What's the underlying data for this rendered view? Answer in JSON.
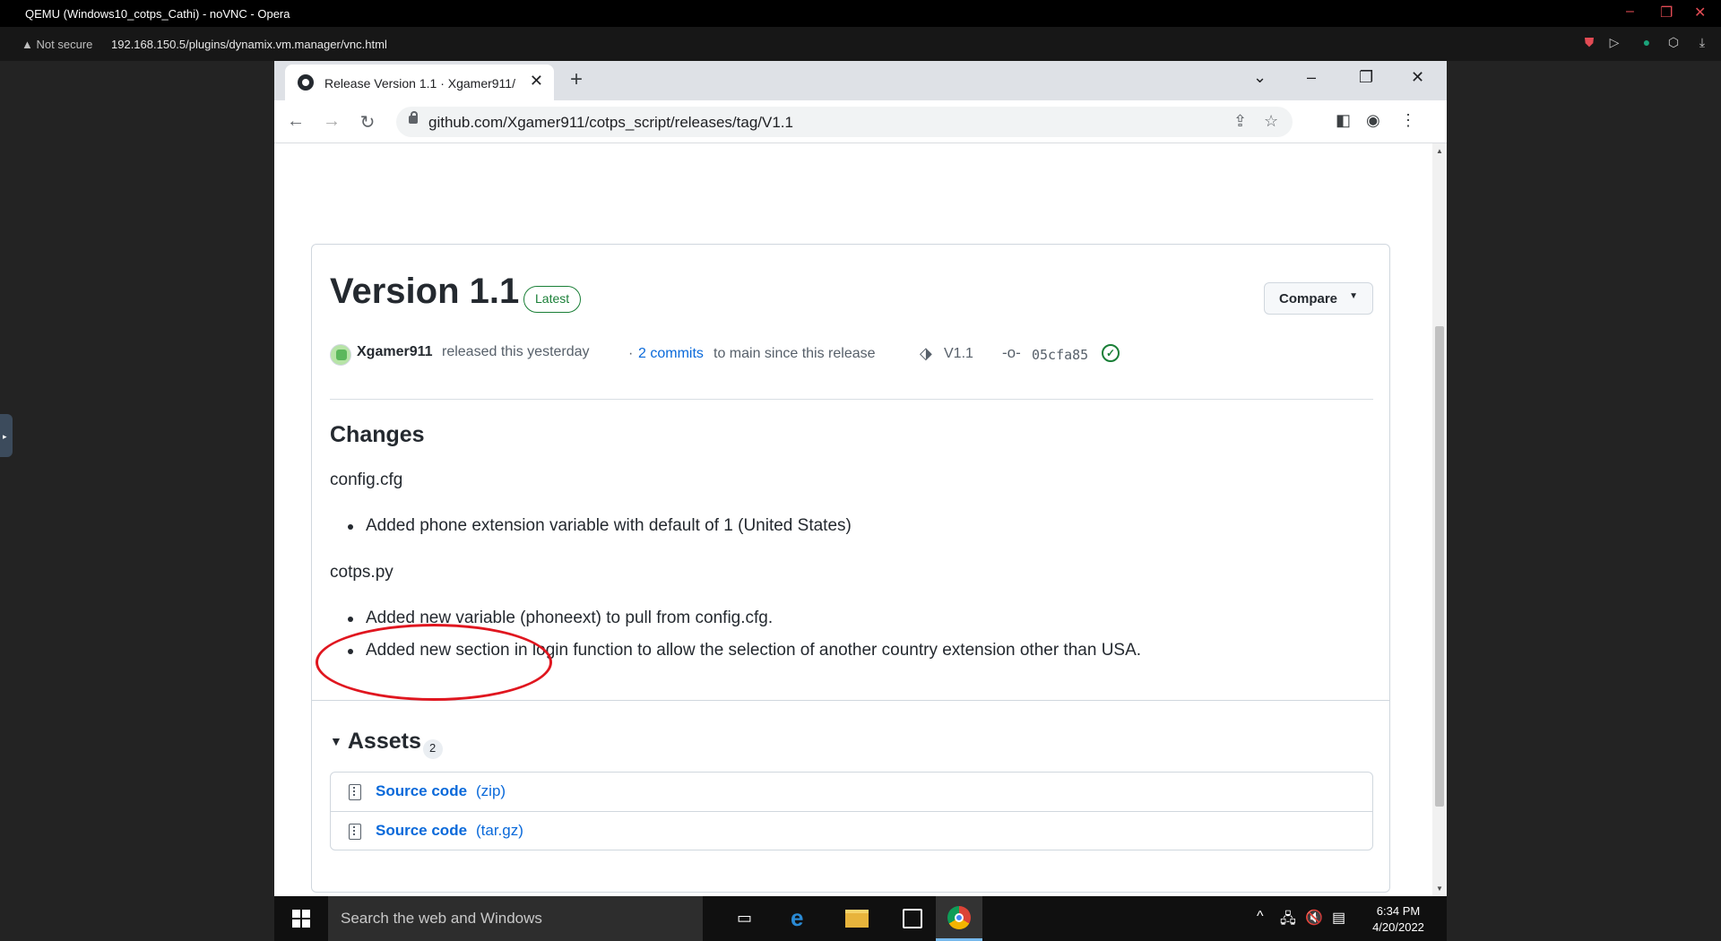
{
  "opera": {
    "title": "QEMU (Windows10_cotps_Cathi) - noVNC - Opera",
    "not_secure": "Not secure",
    "url": "192.168.150.5/plugins/dynamix.vm.manager/vnc.html"
  },
  "chrome": {
    "tab_title": "Release Version 1.1 · Xgamer911/",
    "url": "github.com/Xgamer911/cotps_script/releases/tag/V1.1"
  },
  "release": {
    "title": "Version 1.1",
    "badge": "Latest",
    "compare_label": "Compare",
    "author": "Xgamer911",
    "released_text": "released this yesterday",
    "commits_prefix": "·",
    "commits_link": "2 commits",
    "commits_suffix": "to main since this release",
    "tag": "V1.1",
    "commit_hash": "05cfa85"
  },
  "changes": {
    "heading": "Changes",
    "file1": "config.cfg",
    "file1_items": [
      "Added phone extension variable with default of 1 (United States)"
    ],
    "file2": "cotps.py",
    "file2_items": [
      "Added new variable (phoneext) to pull from config.cfg.",
      "Added new section in login function to allow the selection of another country extension other than USA."
    ]
  },
  "assets": {
    "heading": "Assets",
    "count": "2",
    "items": [
      {
        "name": "Source code",
        "ext": "(zip)"
      },
      {
        "name": "Source code",
        "ext": "(tar.gz)"
      }
    ]
  },
  "taskbar": {
    "search_placeholder": "Search the web and Windows",
    "time": "6:34 PM",
    "date": "4/20/2022"
  },
  "colors": {
    "annotation": "#e0161f",
    "link": "#0969da",
    "latest": "#1a7f37"
  }
}
